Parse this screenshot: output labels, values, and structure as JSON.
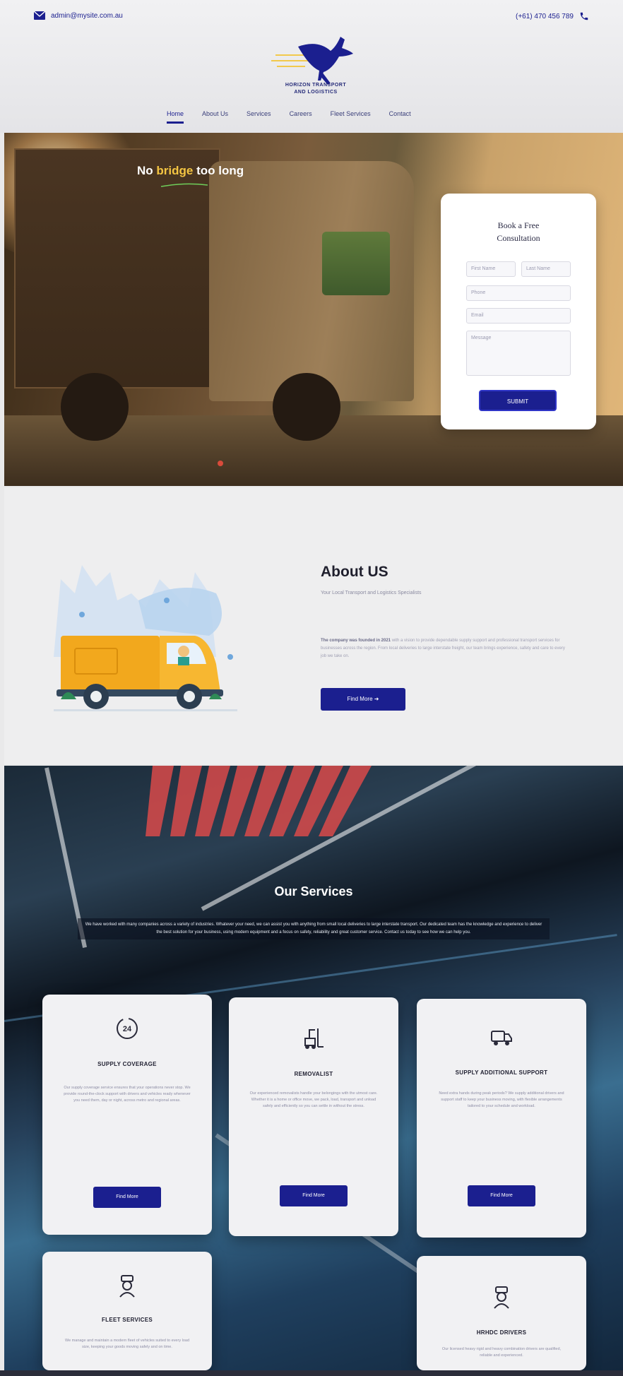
{
  "header": {
    "email": "admin@mysite.com.au",
    "phone": "(+61) 470 456 789",
    "logo_text_line1": "HORIZON TRANSPORT",
    "logo_text_line2": "AND LOGISTICS",
    "nav": [
      "Home",
      "About Us",
      "Services",
      "Careers",
      "Fleet Services",
      "Contact"
    ]
  },
  "hero": {
    "title_start": "No ",
    "title_highlight": "bridge",
    "title_end": " too long",
    "form": {
      "title_line1": "Book a Free",
      "title_line2": "Consultation",
      "first_name_placeholder": "First Name",
      "last_name_placeholder": "Last Name",
      "phone_placeholder": "Phone",
      "email_placeholder": "Email",
      "message_placeholder": "Message",
      "submit_label": "SUBMIT"
    }
  },
  "about": {
    "title": "About US",
    "subtitle": "Your Local Transport and Logistics Specialists",
    "body_bold": "The company was founded in 2021",
    "body_rest": " with a vision to provide dependable supply support and professional transport services for businesses across the region. From local deliveries to large interstate freight, our team brings experience, safety and care to every job we take on.",
    "button_label": "Find More"
  },
  "services": {
    "title": "Our Services",
    "intro": "We have worked with many companies across a variety of industries. Whatever your need, we can assist you with anything from small local deliveries to large interstate transport. Our dedicated team has the knowledge and experience to deliver the best solution for your business, using modern equipment and a focus on safety, reliability and great customer service. Contact us today to see how we can help you.",
    "cards": [
      {
        "title": "SUPPLY COVERAGE",
        "text": "Our supply coverage service ensures that your operations never stop. We provide round-the-clock support with drivers and vehicles ready whenever you need them, day or night, across metro and regional areas.",
        "button": "Find More"
      },
      {
        "title": "REMOVALIST",
        "text": "Our experienced removalists handle your belongings with the utmost care. Whether it is a home or office move, we pack, load, transport and unload safely and efficiently so you can settle in without the stress.",
        "button": "Find More"
      },
      {
        "title": "SUPPLY ADDITIONAL SUPPORT",
        "text": "Need extra hands during peak periods? We supply additional drivers and support staff to keep your business moving, with flexible arrangements tailored to your schedule and workload.",
        "button": "Find More"
      },
      {
        "title": "FLEET SERVICES",
        "text": "We manage and maintain a modern fleet of vehicles suited to every load size, keeping your goods moving safely and on time."
      },
      {
        "title": "HRHDC DRIVERS",
        "text": "Our licensed heavy rigid and heavy combination drivers are qualified, reliable and experienced."
      }
    ]
  }
}
